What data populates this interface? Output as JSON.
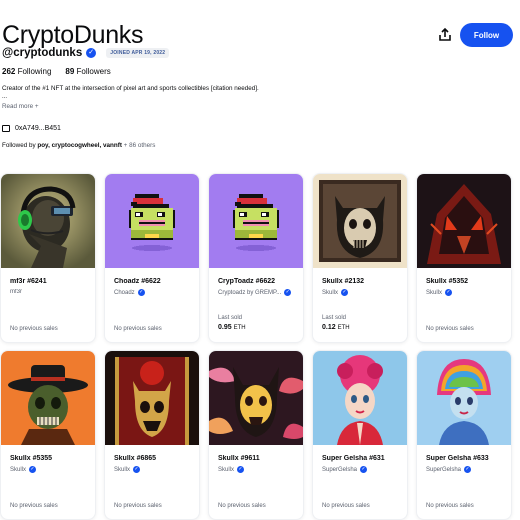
{
  "profile": {
    "name": "CryptoDunks",
    "handle": "@cryptodunks",
    "joined": "JOINED APR 19, 2022",
    "following_count": "262",
    "following_label": "Following",
    "followers_count": "89",
    "followers_label": "Followers",
    "bio": "Creator of the #1 NFT at the intersection of pixel art and sports collectibles [citation needed].",
    "bio_ellipsis": "...",
    "read_more": "Read more +",
    "wallet": "0xA749...B451",
    "followed_by_prefix": "Followed by",
    "followed_by_names": "poy, cryptocogwheel, vannft",
    "followed_by_more": "+ 86 others"
  },
  "actions": {
    "share_icon": "share-icon",
    "follow_label": "Follow"
  },
  "colors": {
    "accent": "#1652f0",
    "muted": "#5b616e"
  },
  "nfts": [
    {
      "title": "mf3r #6241",
      "creator": "mf3r",
      "verified": false,
      "sales": "No previous sales",
      "art": "headset-ape"
    },
    {
      "title": "Choadz #6622",
      "creator": "Choadz",
      "verified": true,
      "sales": "No previous sales",
      "art": "pixel-toad"
    },
    {
      "title": "CrypToadz #6622",
      "creator": "Cryptoadz by GREMP...",
      "verified": true,
      "last_sold_label": "Last sold",
      "last_sold_value": "0.95",
      "last_sold_unit": "ETH",
      "art": "pixel-toad"
    },
    {
      "title": "Skullx #2132",
      "creator": "Skullx",
      "verified": true,
      "last_sold_label": "Last sold",
      "last_sold_value": "0.12",
      "last_sold_unit": "ETH",
      "art": "skull-frame"
    },
    {
      "title": "Skullx #5352",
      "creator": "Skullx",
      "verified": true,
      "sales": "No previous sales",
      "art": "skull-red"
    },
    {
      "title": "Skullx #5355",
      "creator": "Skullx",
      "verified": true,
      "sales": "No previous sales",
      "art": "skull-hat"
    },
    {
      "title": "Skullx #6865",
      "creator": "Skullx",
      "verified": true,
      "sales": "No previous sales",
      "art": "skull-throne"
    },
    {
      "title": "Skullx #9611",
      "creator": "Skullx",
      "verified": true,
      "sales": "No previous sales",
      "art": "skull-leaves"
    },
    {
      "title": "Super Gelsha #631",
      "creator": "SuperGelsha",
      "verified": true,
      "sales": "No previous sales",
      "art": "geisha-red"
    },
    {
      "title": "Super Gelsha #633",
      "creator": "SuperGelsha",
      "verified": true,
      "sales": "No previous sales",
      "art": "geisha-rainbow"
    }
  ]
}
